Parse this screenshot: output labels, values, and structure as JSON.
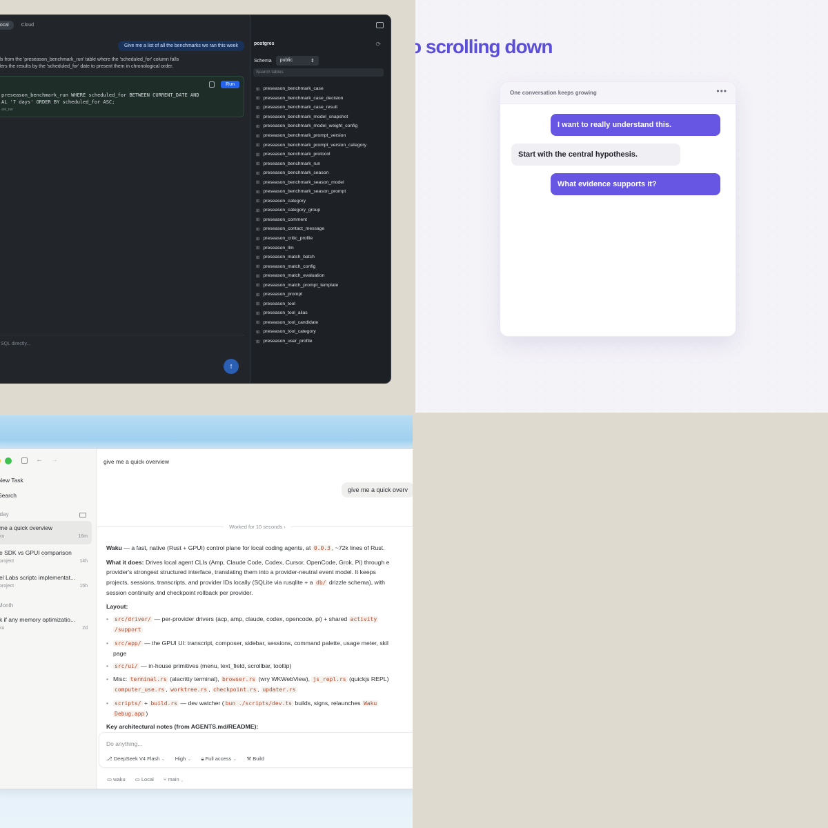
{
  "sql_app": {
    "toggle_local": "Local",
    "toggle_cloud": "Cloud",
    "user_message": "Give me a list of all the benchmarks we ran this week",
    "explanation_lines": [
      "ds from the 'preseason_benchmark_run' table where the 'scheduled_for' column falls",
      "ders the results by the 'scheduled_for' date to present them in chronological order."
    ],
    "sql_lines": [
      "preseason_benchmark_run WHERE scheduled_for BETWEEN CURRENT_DATE AND",
      "AL '7 days' ORDER BY scheduled_for ASC;"
    ],
    "sql_caption": "ark_run",
    "run_label": "Run",
    "composer_placeholder": "SQL directly...",
    "send_glyph": "↑",
    "db_name": "postgres",
    "schema_label": "Schema",
    "schema_value": "public",
    "search_placeholder": "Search tables",
    "tables": [
      "preseason_benchmark_case",
      "preseason_benchmark_case_decision",
      "preseason_benchmark_case_result",
      "preseason_benchmark_model_snapshot",
      "preseason_benchmark_model_weight_config",
      "preseason_benchmark_prompt_version",
      "preseason_benchmark_prompt_version_category",
      "preseason_benchmark_protocol",
      "preseason_benchmark_run",
      "preseason_benchmark_season",
      "preseason_benchmark_season_model",
      "preseason_benchmark_season_prompt",
      "preseason_category",
      "preseason_category_group",
      "preseason_comment",
      "preseason_contact_message",
      "preseason_critic_profile",
      "preseason_llm",
      "preseason_match_batch",
      "preseason_match_config",
      "preseason_match_evaluation",
      "preseason_match_prompt_template",
      "preseason_prompt",
      "preseason_tool",
      "preseason_tool_alias",
      "preseason_tool_candidate",
      "preseason_tool_category",
      "preseason_user_profile"
    ]
  },
  "scroll_demo": {
    "headline": "o scrolling down",
    "card_title": "One conversation keeps growing",
    "menu_glyph": "•••",
    "messages": [
      {
        "role": "user",
        "text": "I want to really understand this."
      },
      {
        "role": "assistant",
        "text": "Start with the central hypothesis."
      },
      {
        "role": "user",
        "text": "What evidence supports it?"
      }
    ]
  },
  "agent_app": {
    "new_task": "New Task",
    "search": "Search",
    "group_yesterday": "rday",
    "group_month": "Month",
    "tasks": [
      {
        "title": "me a quick overview",
        "sub": "ku",
        "age": "16m"
      },
      {
        "title": "e SDK vs GPUI comparison",
        "sub": "project",
        "age": "14h"
      },
      {
        "title": "el Labs scriptc implementat...",
        "sub": "project",
        "age": "15h"
      },
      {
        "title": "k if any memory optimizatio...",
        "sub": "ku",
        "age": "2d"
      }
    ],
    "thread_title": "give me a quick overview",
    "user_bubble": "give me a quick overv",
    "worked": "Worked for 10 seconds  ›",
    "intro_name": "Waku",
    "intro_text_1": " — a fast, native (Rust + GPUI) control plane for local coding agents, at ",
    "intro_version": "0.0.3",
    "intro_text_2": ", ~72k lines of Rust.",
    "what_label": "What it does:",
    "what_line_1": " Drives local agent CLIs (Amp, Claude Code, Codex, Cursor, OpenCode, Grok, Pi) through e",
    "what_line_2": "provider's strongest structured interface, translating them into a provider-neutral event model. It keeps",
    "what_line_3a": "projects, sessions, transcripts, and provider IDs locally (SQLite via rusqlite + a ",
    "what_code": "db/",
    "what_line_3b": " drizzle schema), with",
    "what_line_4": "session continuity and checkpoint rollback per provider.",
    "layout_label": "Layout:",
    "l1_code": "src/driver/",
    "l1_text": " — per-provider drivers (acp, amp, claude, codex, opencode, pi) + shared ",
    "l1_code2": "activity",
    "l1_code3": "/support",
    "l2_code": "src/app/",
    "l2_text": " — the GPUI UI: transcript, composer, sidebar, sessions, command palette, usage meter, skil",
    "l2_text2": "page",
    "l3_code": "src/ui/",
    "l3_text": " — in-house primitives (menu, text_field, scrollbar, tooltip)",
    "l4_text": "Misc: ",
    "l4_c1": "terminal.rs",
    "l4_t1": " (alacritty terminal), ",
    "l4_c2": "browser.rs",
    "l4_t2": " (wry WKWebView), ",
    "l4_c3": "js_repl.rs",
    "l4_t3": " (quickjs REPL)",
    "l4_c4": "computer_use.rs",
    "l4_c5": "worktree.rs",
    "l4_c6": "checkpoint.rs",
    "l4_c7": "updater.rs",
    "comma": ", ",
    "l5_c1": "scripts/",
    "plus": " + ",
    "l5_c2": "build.rs",
    "l5_t1": " — dev watcher (",
    "l5_c3": "bun ./scripts/dev.ts",
    "l5_t2": " builds, signs, relaunches ",
    "l5_c4": "Waku",
    "l5_c5": "Debug.app",
    "l5_close": ")",
    "notes_label": "Key architectural notes (from AGENTS.md/README):",
    "composer_placeholder": "Do anything...",
    "model": "DeepSeek V4 Flash",
    "effort": "High",
    "access": "Full access",
    "mode": "Build",
    "footer_project": "waku",
    "footer_location": "Local",
    "footer_branch": "main"
  }
}
